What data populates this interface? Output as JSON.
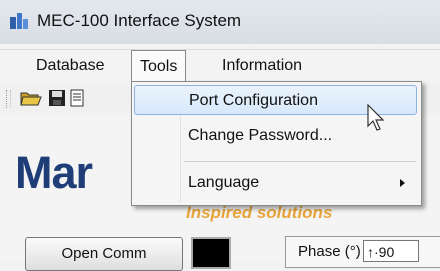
{
  "window": {
    "title": "MEC-100 Interface System"
  },
  "menubar": {
    "items": [
      {
        "label": "Database"
      },
      {
        "label": "Tools"
      },
      {
        "label": "Information"
      }
    ]
  },
  "tools_menu": {
    "items": [
      {
        "label": "Port Configuration"
      },
      {
        "label": "Change Password..."
      },
      {
        "label": "Language"
      }
    ]
  },
  "main": {
    "logo_text": "Mar",
    "tagline": "Inspired solutions",
    "open_comm_label": "Open Comm",
    "phase_label": "Phase (°)",
    "phase_value": "↑·90"
  },
  "colors": {
    "logo": "#1f3e78",
    "tagline": "#e8a53c",
    "menu_highlight": "#d7e8fb"
  }
}
